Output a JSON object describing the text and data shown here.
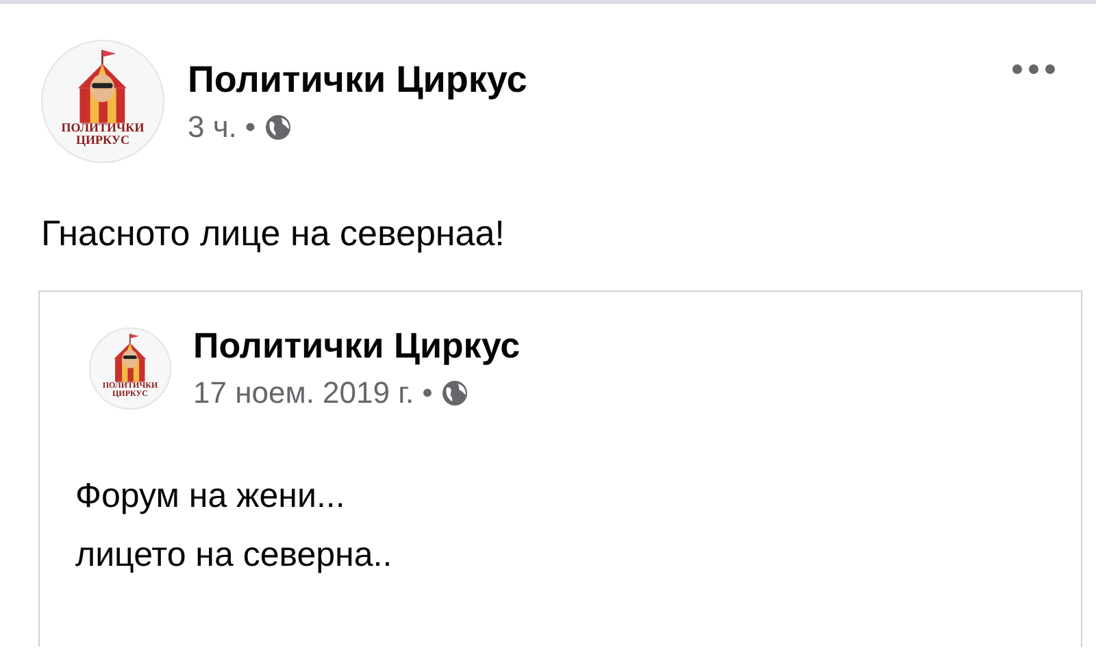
{
  "post": {
    "author": "Политички Циркус",
    "avatar_text": [
      "ПОЛИТИЧКИ",
      "ЦИРКУС"
    ],
    "time": "3 ч.",
    "separator": "•",
    "text": "Гнасното лице на севернаа!"
  },
  "shared_post": {
    "author": "Политички Циркус",
    "avatar_text": [
      "ПОЛИТИЧКИ",
      "ЦИРКУС"
    ],
    "time": "17 ноем. 2019 г.",
    "separator": "•",
    "lines": [
      "Форум на жени...",
      "лицето на северна.."
    ]
  }
}
